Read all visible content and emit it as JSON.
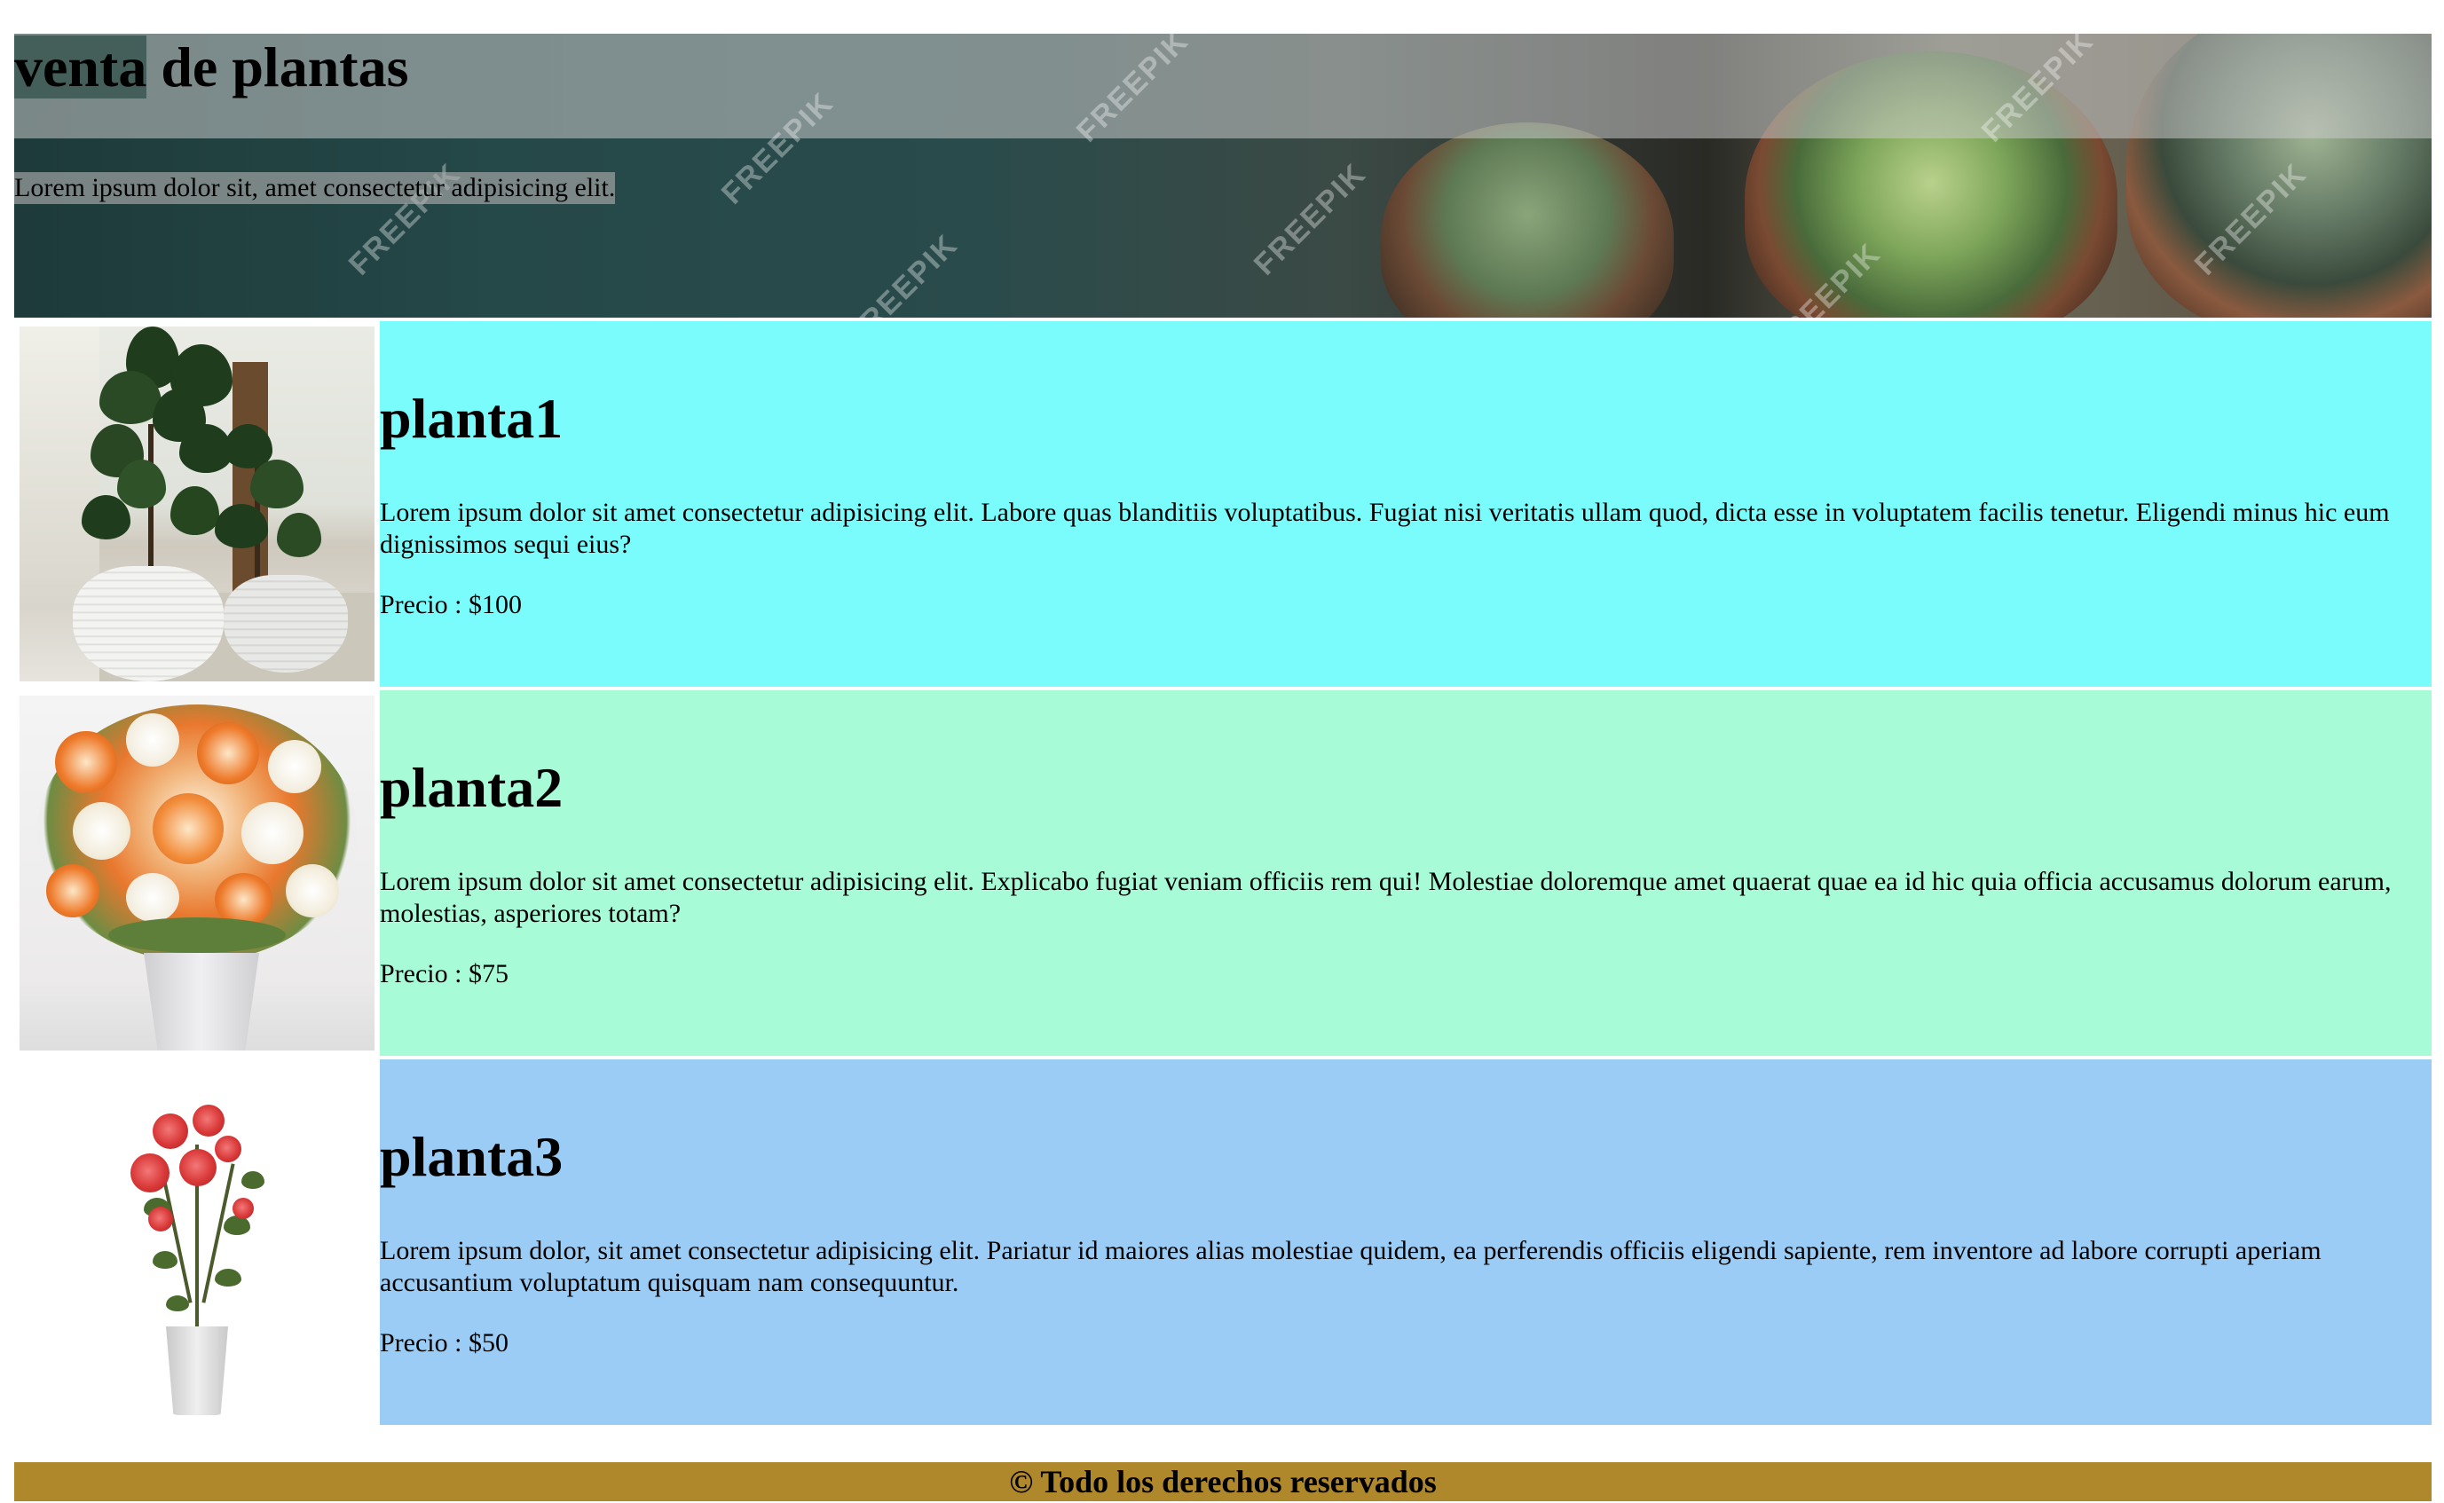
{
  "header": {
    "title_highlight": "venta",
    "title_rest": " de plantas",
    "subtitle": "Lorem ipsum dolor sit, amet consectetur adipisicing elit.",
    "watermark": "FREEPIK"
  },
  "products": [
    {
      "name": "planta1",
      "description": "Lorem ipsum dolor sit amet consectetur adipisicing elit. Labore quas blanditiis voluptatibus. Fugiat nisi veritatis ullam quod, dicta esse in voluptatem facilis tenetur. Eligendi minus hic eum dignissimos sequi eius?",
      "price": "Precio : $100",
      "background": "#7afcfc"
    },
    {
      "name": "planta2",
      "description": "Lorem ipsum dolor sit amet consectetur adipisicing elit. Explicabo fugiat veniam officiis rem qui! Molestiae doloremque amet quaerat quae ea id hic quia officia accusamus dolorum earum, molestias, asperiores totam?",
      "price": "Precio : $75",
      "background": "#a7fbd6"
    },
    {
      "name": "planta3",
      "description": "Lorem ipsum dolor, sit amet consectetur adipisicing elit. Pariatur id maiores alias molestiae quidem, ea perferendis officiis eligendi sapiente, rem inventore ad labore corrupti aperiam accusantium voluptatum quisquam nam consequuntur.",
      "price": "Precio : $50",
      "background": "#9accf5"
    }
  ],
  "footer": {
    "text": "© Todo los derechos reservados",
    "background": "#b0882c"
  }
}
